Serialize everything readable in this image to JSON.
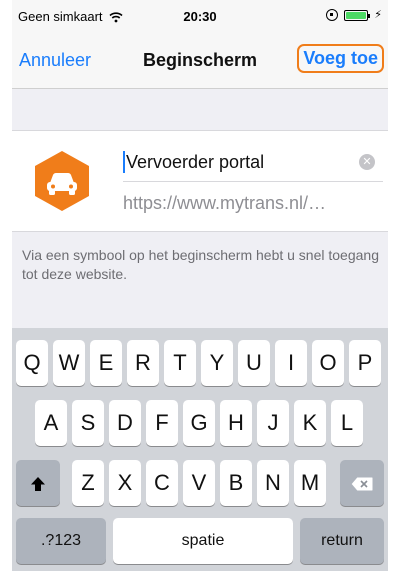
{
  "status_bar": {
    "carrier": "Geen simkaart",
    "time": "20:30"
  },
  "nav": {
    "cancel_label": "Annuleer",
    "title": "Beginscherm",
    "add_label": "Voeg toe"
  },
  "bookmark": {
    "name": "Vervoerder portal",
    "url": "https://www.mytrans.nl/…",
    "icon": "truck-icon",
    "icon_color": "#f07d1a"
  },
  "info_text": "Via een symbool op het beginscherm hebt u snel toegang tot deze website.",
  "keyboard": {
    "row1": [
      "Q",
      "W",
      "E",
      "R",
      "T",
      "Y",
      "U",
      "I",
      "O",
      "P"
    ],
    "row2": [
      "A",
      "S",
      "D",
      "F",
      "G",
      "H",
      "J",
      "K",
      "L"
    ],
    "row3": [
      "Z",
      "X",
      "C",
      "V",
      "B",
      "N",
      "M"
    ],
    "numbers_label": ".?123",
    "space_label": "spatie",
    "return_label": "return"
  },
  "colors": {
    "accent": "#1a7dfc",
    "highlight": "#f07d1a"
  }
}
